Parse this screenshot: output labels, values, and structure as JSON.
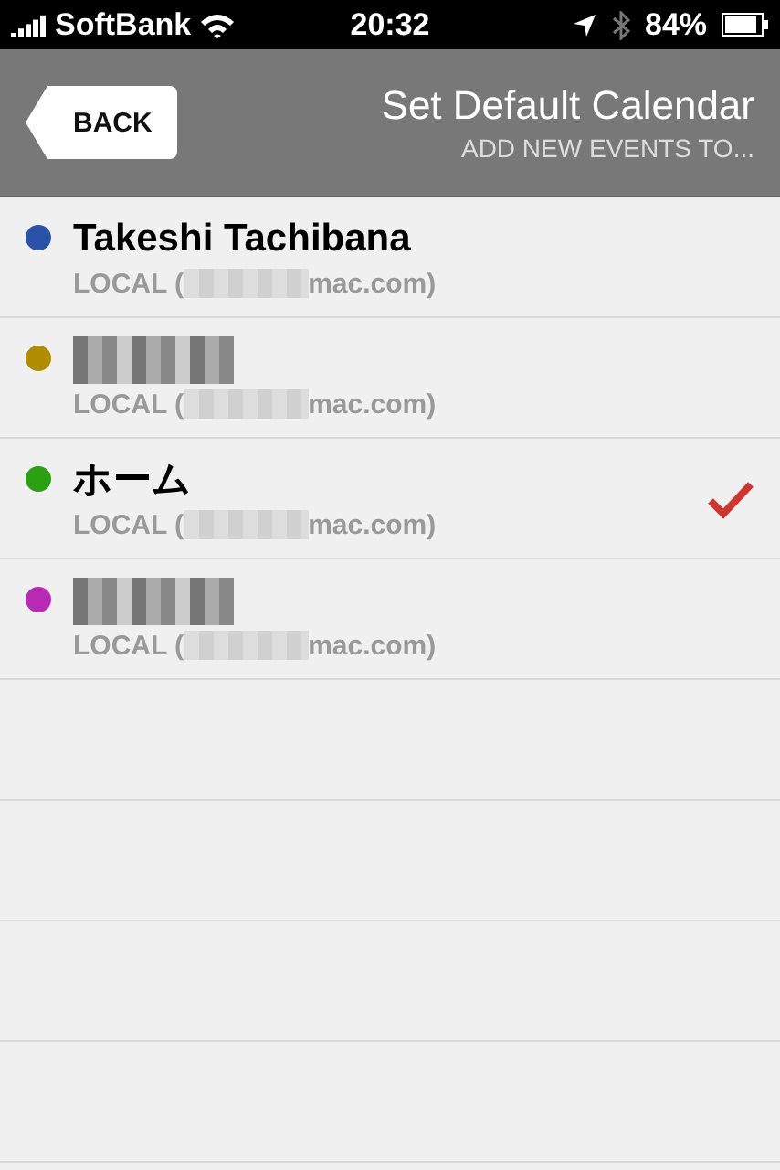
{
  "status_bar": {
    "carrier": "SoftBank",
    "time": "20:32",
    "battery": "84%"
  },
  "nav_bar": {
    "back_button": "BACK",
    "title": "Set Default Calendar",
    "subtitle": "ADD NEW EVENTS TO..."
  },
  "calendars": [
    {
      "kind": "named",
      "name": "Takeshi Tachibana",
      "account_prefix": "LOCAL (",
      "account_suffix": "mac.com)",
      "color": "#2a52a8",
      "selected": false
    },
    {
      "kind": "redacted",
      "account_prefix": "LOCAL (",
      "account_suffix": "mac.com)",
      "color": "#b08c00",
      "selected": false
    },
    {
      "kind": "named",
      "name": "ホーム",
      "account_prefix": "LOCAL (",
      "account_suffix": "mac.com)",
      "color": "#2aa012",
      "selected": true
    },
    {
      "kind": "redacted",
      "account_prefix": "LOCAL (",
      "account_suffix": "mac.com)",
      "color": "#b82ab4",
      "selected": false
    }
  ]
}
